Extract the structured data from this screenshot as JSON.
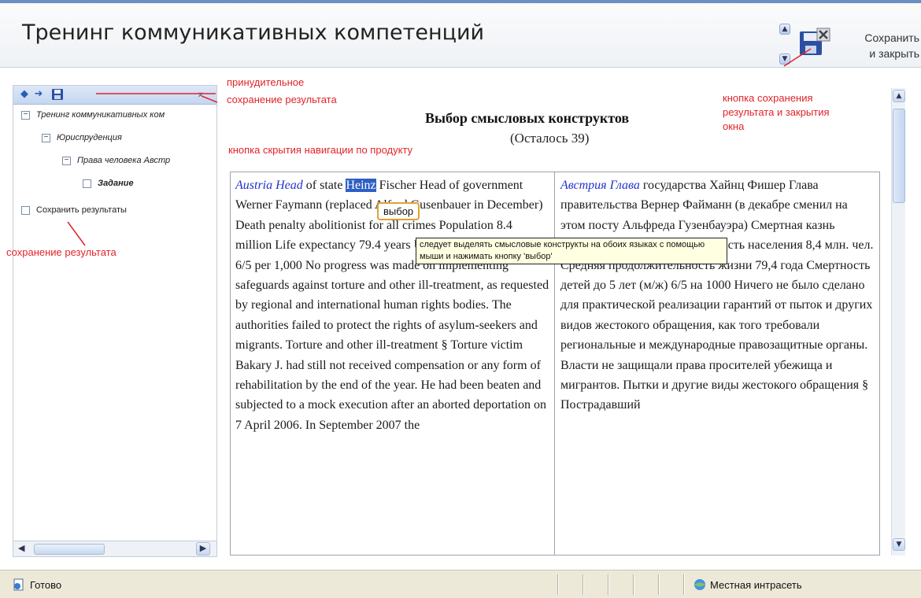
{
  "app_title": "Тренинг коммуникативных компетенций",
  "header": {
    "save_close_label_line1": "Сохранить",
    "save_close_label_line2": "и закрыть",
    "save_close_icon": "floppy-close-icon"
  },
  "nav": {
    "toolbar_icons": [
      "back-arrow-icon",
      "forward-arrow-icon",
      "save-icon",
      "collapse-icon"
    ],
    "tree": [
      {
        "label": "Тренинг коммуникативных ком",
        "expanded": true,
        "level": 0
      },
      {
        "label": "Юриспруденция",
        "expanded": true,
        "level": 1
      },
      {
        "label": "Права человека Австр",
        "expanded": true,
        "level": 2
      },
      {
        "label": "Задание",
        "expanded": false,
        "level": 3
      },
      {
        "label": "Сохранить результаты",
        "expanded": false,
        "level": 0
      }
    ]
  },
  "content": {
    "title": "Выбор смысловых конструктов",
    "remaining": "(Осталось 39)",
    "en": {
      "link": "Austria Head",
      "before_selection": " of state ",
      "selected_word": "Heinz",
      "after_selection": " Fischer Head of government Werner Faymann (replaced Alfred Gusenbauer in December) Death penalty abolitionist for all crimes Population 8.4 million Life expectancy 79.4 years Under-5 mortality (m/f) 6/5 per 1,000 No progress was made on implementing safeguards against torture and other ill-treatment, as requested by regional and international human rights bodies. The authorities failed to protect the rights of asylum-seekers and migrants. Torture and other ill-treatment § Torture victim Bakary J. had still not received compensation or any form of rehabilitation by the end of the year. He had been beaten and subjected to a mock execution after an aborted deportation on 7 April 2006. In September 2007 the"
    },
    "ru": {
      "link": "Австрия Глава",
      "text": " государства Хайнц Фишер Глава правительства Вернер Файманн (в декабре сменил на этом посту Альфреда Гузенбауэра) Смертная казнь полностью отменена Численность населения 8,4 млн. чел. Средняя продолжительность жизни 79,4 года Смертность детей до 5 лет (м/ж) 6/5 на 1000 Ничего не было сделано для практической реализации гарантий от пыток и других видов жестокого обращения, как того требовали региональные и международные правозащитные органы. Власти не защищали права просителей убежища и мигрантов. Пытки и другие виды жестокого обращения § Пострадавший"
    },
    "select_popup": "выбор",
    "tooltip": "следует выделять смысловые конструкты на обоих языках с помощью мыши и нажимать кнопку 'выбор'"
  },
  "annotations": {
    "forced_save": "принудительное\nсохранение результата",
    "hide_nav": "кнопка скрытия навигации по продукту",
    "save_close": "кнопка сохранения\nрезультата и закрытия\nокна",
    "save_result": "сохранение результата"
  },
  "statusbar": {
    "status": "Готово",
    "zone": "Местная интрасеть",
    "status_icon": "page-icon",
    "zone_icon": "intranet-icon"
  },
  "colors": {
    "annotation": "#e0242a",
    "link": "#2233cc",
    "selection": "#2f5fc3",
    "tooltip_bg": "#ffffe1"
  }
}
